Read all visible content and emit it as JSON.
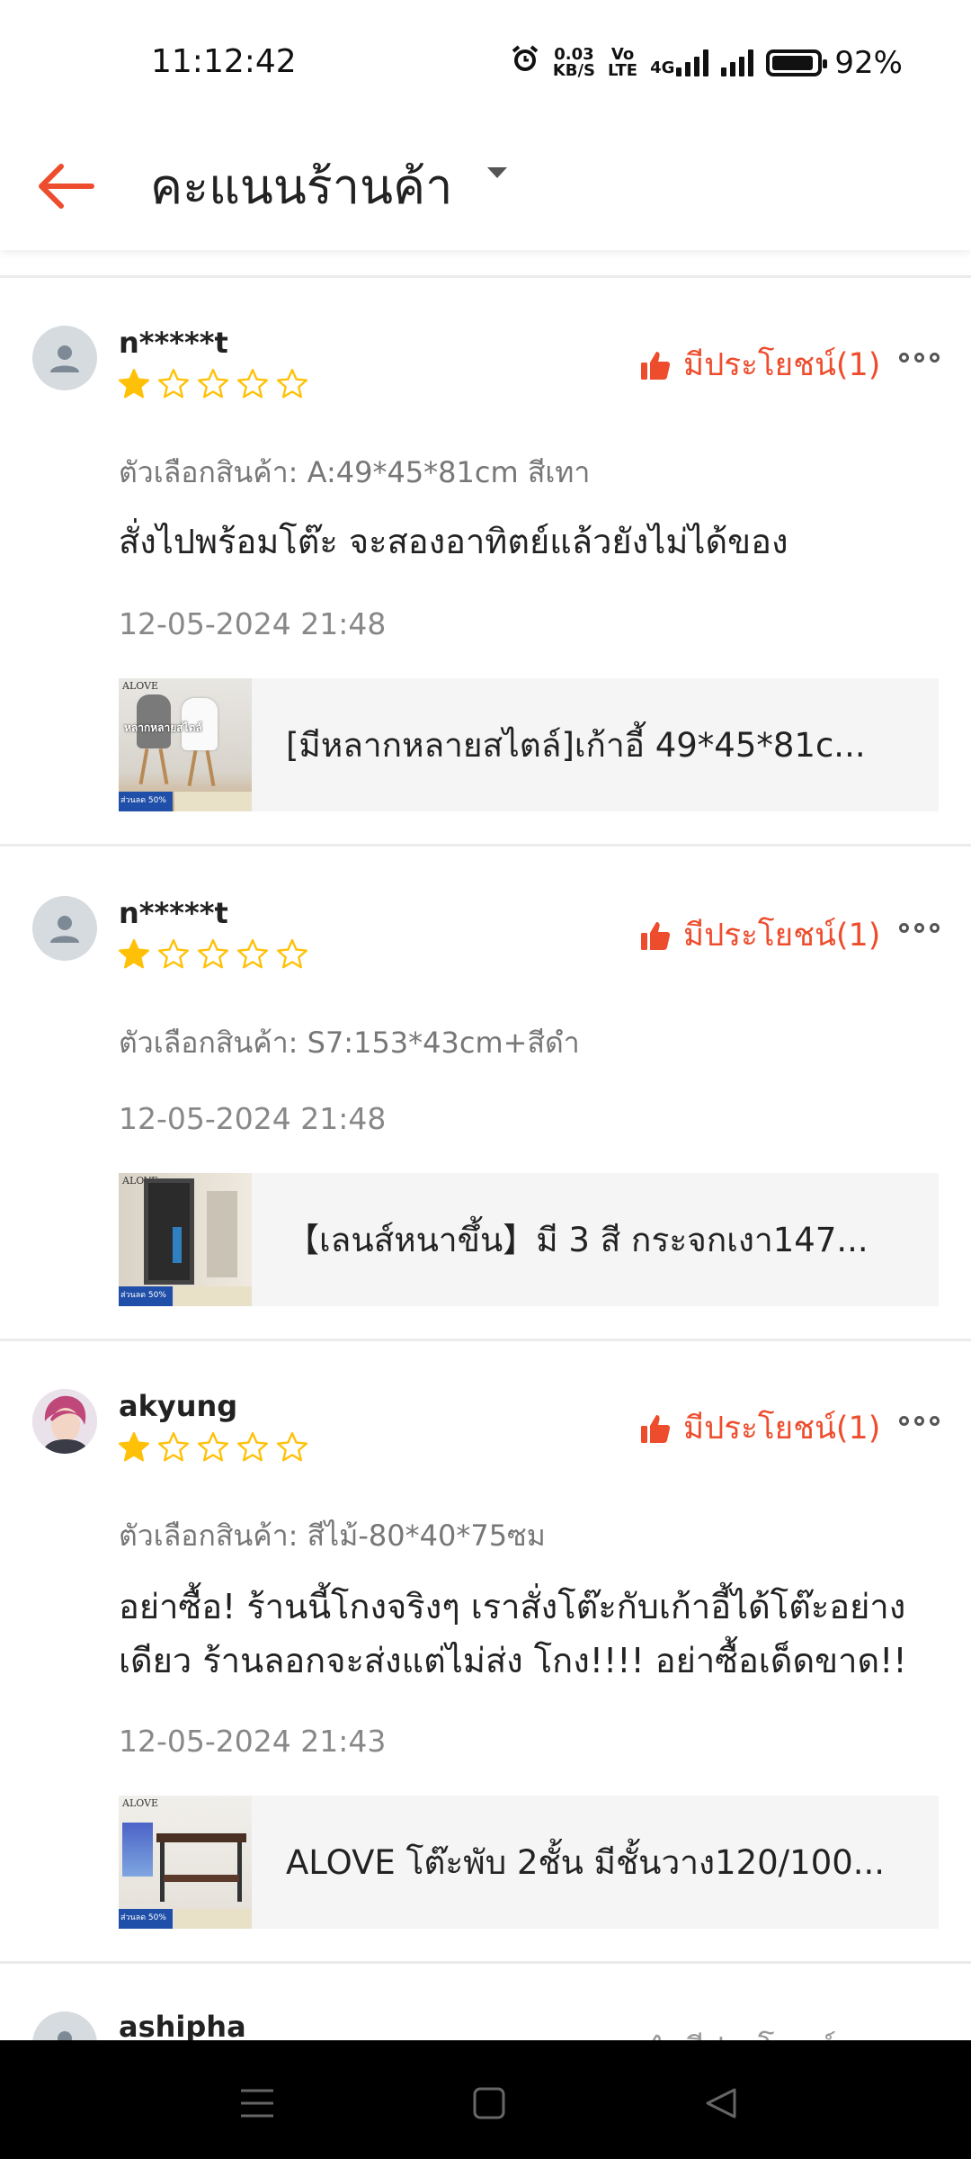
{
  "status_bar": {
    "time": "11:12:42",
    "net_speed_top": "0.03",
    "net_speed_bottom": "KB/S",
    "volte_top": "Vo",
    "volte_bottom": "LTE",
    "network": "4G",
    "battery": "92%",
    "battery_level": 0.92
  },
  "header": {
    "title": "คะแนนร้านค้า",
    "accent_color": "#ee4d2d"
  },
  "reviews": [
    {
      "username": "n*****t",
      "rating": 1,
      "helpful_label": "มีประโยชน์(1)",
      "variation": "ตัวเลือกสินค้า: A:49*45*81cm สีเทา",
      "comment": "สั่งไปพร้อมโต๊ะ จะสองอาทิตย์แล้วยังไม่ได้ของ",
      "date": "12-05-2024 21:48",
      "product_name": "[มีหลากหลายสไตล์]เก้าอี้ 49*45*81c...",
      "thumb_brand": "ALOVE",
      "thumb_text": "หลากหลายสไตล์",
      "thumb_badge": "ส่วนลด 50%"
    },
    {
      "username": "n*****t",
      "rating": 1,
      "helpful_label": "มีประโยชน์(1)",
      "variation": "ตัวเลือกสินค้า: S7:153*43cm+สีดำ",
      "comment": "",
      "date": "12-05-2024 21:48",
      "product_name": "【เลนส์หนาขึ้น】มี 3 สี กระจกเงา147...",
      "thumb_brand": "ALOVE",
      "thumb_badge": "ส่วนลด 50%"
    },
    {
      "username": "akyung",
      "rating": 1,
      "helpful_label": "มีประโยชน์(1)",
      "variation": "ตัวเลือกสินค้า: สีไม้-80*40*75ซม",
      "comment": "อย่าซื้อ! ร้านนี้โกงจริงๆ เราสั่งโต๊ะกับเก้าอี้ได้โต๊ะอย่างเดียว ร้านลอกจะส่งแต่ไม่ส่ง โกง!!!! อย่าซื้อเด็ดขาด!!",
      "date": "12-05-2024 21:43",
      "product_name": "ALOVE โต๊ะพับ 2ชั้น มีชั้นวาง120/100...",
      "thumb_brand": "ALOVE",
      "thumb_badge": "ส่วนลด 50%"
    },
    {
      "username": "ashipha",
      "helpful_label": "มีประโยชน์"
    }
  ]
}
